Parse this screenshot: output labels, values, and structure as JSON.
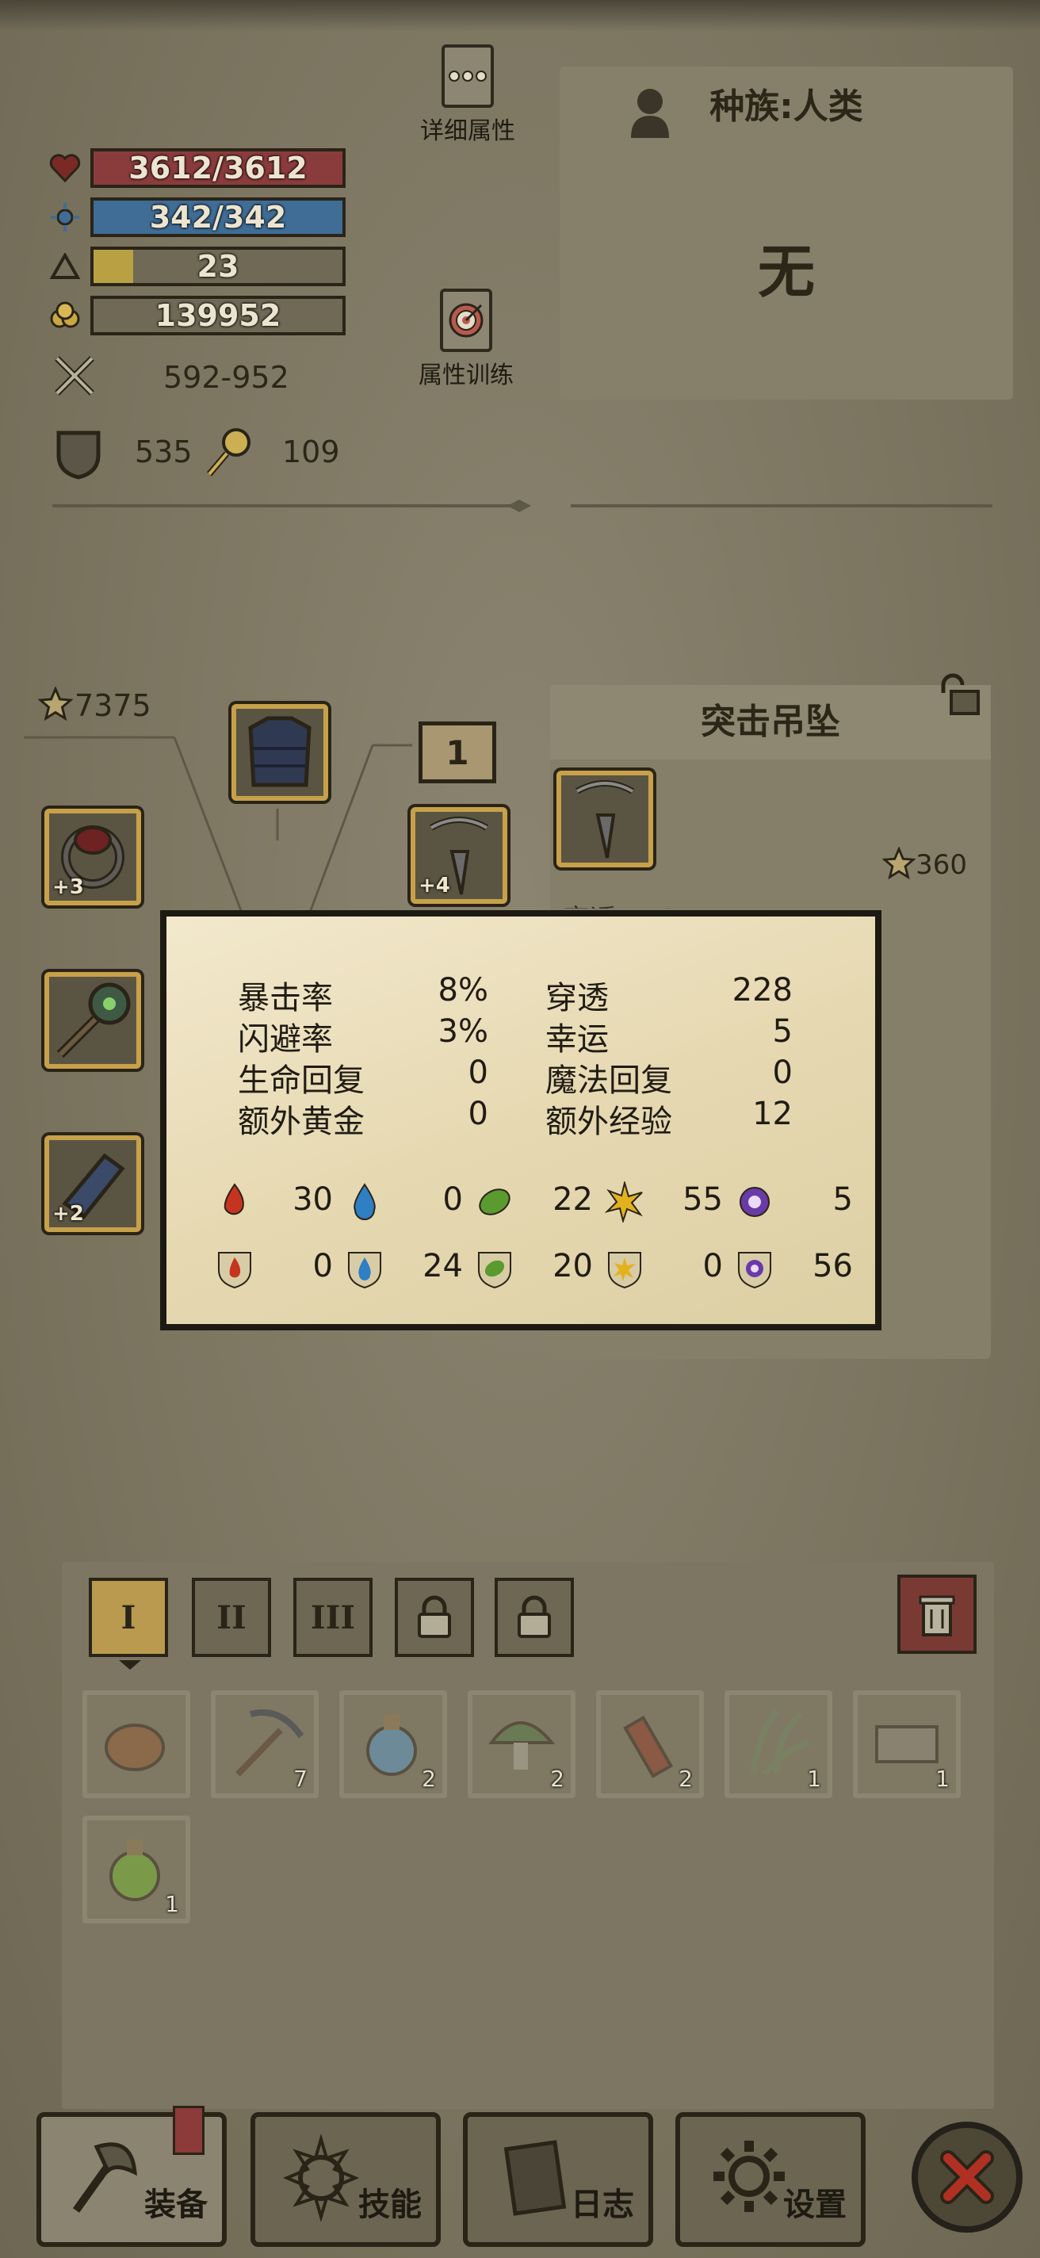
{
  "stats": {
    "hp": "3612/3612",
    "mp": "342/342",
    "level": "23",
    "gold": "139952",
    "attack": "592-952",
    "defense": "535",
    "magic_defense": "109"
  },
  "top_buttons": {
    "details": "详细属性",
    "training": "属性训练"
  },
  "race": {
    "title": "种族:人类",
    "value": "无"
  },
  "equipment": {
    "score": "7375",
    "slot_level": "1",
    "slots": [
      {
        "name": "ring",
        "plus": "+3"
      },
      {
        "name": "weapon",
        "plus": ""
      },
      {
        "name": "bracer",
        "plus": "+2"
      },
      {
        "name": "armor",
        "plus": ""
      },
      {
        "name": "pendant",
        "plus": "+4"
      }
    ]
  },
  "item_panel": {
    "title": "突击吊坠",
    "score": "360",
    "partial_text": "穿透 : 52"
  },
  "tooltip": {
    "rows": [
      {
        "k1": "暴击率",
        "v1": "8%",
        "k2": "穿透",
        "v2": "228"
      },
      {
        "k1": "闪避率",
        "v1": "3%",
        "k2": "幸运",
        "v2": "5"
      },
      {
        "k1": "生命回复",
        "v1": "0",
        "k2": "魔法回复",
        "v2": "0"
      },
      {
        "k1": "额外黄金",
        "v1": "0",
        "k2": "额外经验",
        "v2": "12"
      }
    ],
    "element_attack": [
      {
        "icon": "fire-attack-icon",
        "color": "#c5341f",
        "value": "30"
      },
      {
        "icon": "water-attack-icon",
        "color": "#2e7fc4",
        "value": "0"
      },
      {
        "icon": "nature-attack-icon",
        "color": "#5a9a2e",
        "value": "22"
      },
      {
        "icon": "lightning-attack-icon",
        "color": "#e2b21e",
        "value": "55"
      },
      {
        "icon": "arcane-attack-icon",
        "color": "#6a3aa8",
        "value": "5"
      }
    ],
    "element_resist": [
      {
        "icon": "fire-resist-icon",
        "color": "#c5341f",
        "value": "0"
      },
      {
        "icon": "water-resist-icon",
        "color": "#2e7fc4",
        "value": "24"
      },
      {
        "icon": "nature-resist-icon",
        "color": "#5a9a2e",
        "value": "20"
      },
      {
        "icon": "lightning-resist-icon",
        "color": "#e2b21e",
        "value": "0"
      },
      {
        "icon": "arcane-resist-icon",
        "color": "#6a3aa8",
        "value": "56"
      }
    ]
  },
  "inventory": {
    "tabs": [
      "I",
      "II",
      "III"
    ],
    "items": [
      {
        "name": "meat-item",
        "count": ""
      },
      {
        "name": "pickaxe-item",
        "count": "7"
      },
      {
        "name": "potion-item",
        "count": "2"
      },
      {
        "name": "mushroom-item",
        "count": "2"
      },
      {
        "name": "dynamite-item",
        "count": "2"
      },
      {
        "name": "herb-item",
        "count": "1"
      },
      {
        "name": "scroll-item",
        "count": "1"
      },
      {
        "name": "green-potion-item",
        "count": "1"
      }
    ]
  },
  "nav": {
    "equip": "装备",
    "skills": "技能",
    "log": "日志",
    "settings": "设置"
  },
  "colors": {
    "hp_bar": "#8a3c3c",
    "mp_bar": "#3f6d96",
    "xp_fill": "#b9a043",
    "gold_frame": "#c7a14a",
    "close_red": "#b03024"
  }
}
